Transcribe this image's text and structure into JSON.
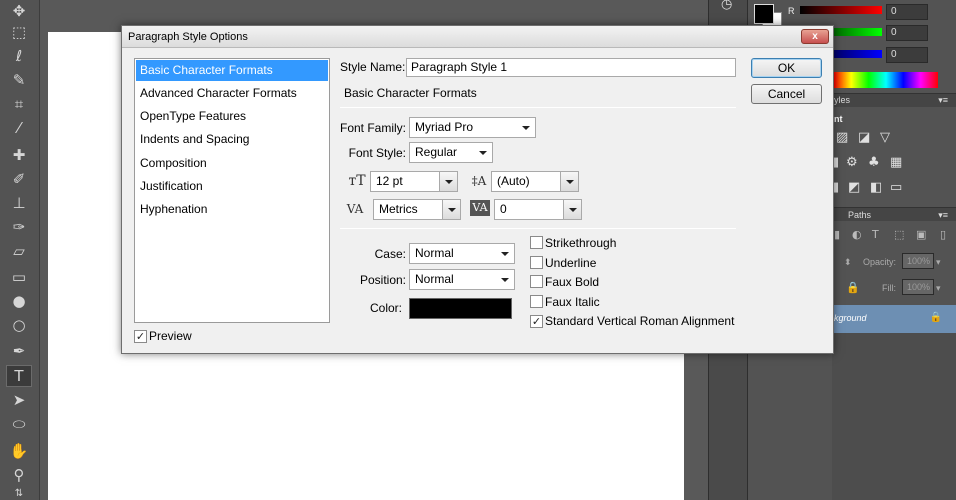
{
  "dialog": {
    "title": "Paragraph Style Options",
    "close_label": "x",
    "categories": [
      "Basic Character Formats",
      "Advanced Character Formats",
      "OpenType Features",
      "Indents and Spacing",
      "Composition",
      "Justification",
      "Hyphenation"
    ],
    "selected_category": "Basic Character Formats",
    "preview_label": "Preview",
    "preview_checked": true,
    "style_name_label": "Style Name:",
    "style_name_value": "Paragraph Style 1",
    "section_title": "Basic Character Formats",
    "font_family_label": "Font Family:",
    "font_family_value": "Myriad Pro",
    "font_style_label": "Font Style:",
    "font_style_value": "Regular",
    "font_size_value": "12 pt",
    "leading_value": "(Auto)",
    "kerning_value": "Metrics",
    "tracking_value": "0",
    "case_label": "Case:",
    "case_value": "Normal",
    "position_label": "Position:",
    "position_value": "Normal",
    "color_label": "Color:",
    "color_value": "#000000",
    "checkboxes": [
      {
        "label": "Strikethrough",
        "checked": false
      },
      {
        "label": "Underline",
        "checked": false
      },
      {
        "label": "Faux Bold",
        "checked": false
      },
      {
        "label": "Faux Italic",
        "checked": false
      },
      {
        "label": "Standard Vertical Roman Alignment",
        "checked": true
      }
    ],
    "ok_label": "OK",
    "cancel_label": "Cancel"
  },
  "photoshop": {
    "color_panel": {
      "r_label": "R",
      "values": [
        "0",
        "0",
        "0"
      ]
    },
    "styles_tab": "yles",
    "layers_panel": {
      "partial_label": "nt",
      "paths_tab": "Paths",
      "opacity_label": "Opacity:",
      "opacity_value": "100%",
      "fill_label": "Fill:",
      "fill_value": "100%",
      "layer_name": "kground"
    },
    "tools": [
      "move-tool",
      "marquee-tool",
      "lasso-tool",
      "quick-selection-tool",
      "crop-tool",
      "eyedropper-tool",
      "healing-brush-tool",
      "brush-tool",
      "clone-stamp-tool",
      "history-brush-tool",
      "eraser-tool",
      "gradient-tool",
      "blur-tool",
      "dodge-tool",
      "pen-tool",
      "type-tool",
      "path-selection-tool",
      "ellipse-tool",
      "hand-tool",
      "zoom-tool"
    ],
    "active_tool": "type-tool"
  },
  "colors": {
    "selection": "#3399ff",
    "ps_background": "#535353",
    "layer_highlight": "#6d8fb3"
  }
}
